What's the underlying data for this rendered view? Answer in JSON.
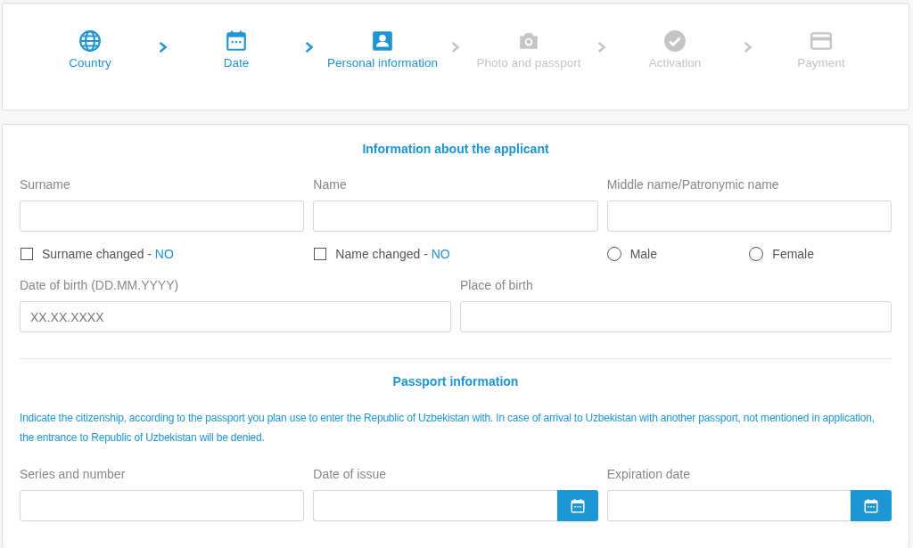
{
  "steps": [
    {
      "label": "Country",
      "done": true
    },
    {
      "label": "Date",
      "done": true
    },
    {
      "label": "Personal information",
      "done": true
    },
    {
      "label": "Photo and passport",
      "done": false
    },
    {
      "label": "Activation",
      "done": false
    },
    {
      "label": "Payment",
      "done": false
    }
  ],
  "applicant": {
    "title": "Information about the applicant",
    "fields": [
      {
        "label": "Surname",
        "kind": "text"
      },
      {
        "label": "Name",
        "kind": "text"
      },
      {
        "label": "Middle name/Patronymic name",
        "kind": "text"
      }
    ],
    "options": [
      {
        "kind": "checkbox",
        "label": "Surname changed -",
        "value": "NO",
        "checked": false
      },
      {
        "kind": "checkbox",
        "label": "Name changed -",
        "value": "NO",
        "checked": false
      },
      {
        "kind": "radio",
        "label": "Male",
        "selected": false
      },
      {
        "kind": "radio",
        "label": "Female",
        "selected": false
      }
    ],
    "birth_fields": [
      {
        "label": "Date of birth (DD.MM.YYYY)",
        "kind": "text",
        "placeholder": "XX.XX.XXXX"
      },
      {
        "label": "Place of birth",
        "kind": "text"
      }
    ]
  },
  "passport": {
    "title": "Passport information",
    "note": "Indicate the citizenship, according to the passport you plan use to enter the Republic of Uzbekistan with. In case of arrival to Uzbekistan with another passport, not mentioned in application, the entrance to Republic of Uzbekistan will be denied.",
    "fields": [
      {
        "label": "Series and number",
        "kind": "text"
      },
      {
        "label": "Date of issue",
        "kind": "date"
      },
      {
        "label": "Expiration date",
        "kind": "date"
      }
    ]
  }
}
